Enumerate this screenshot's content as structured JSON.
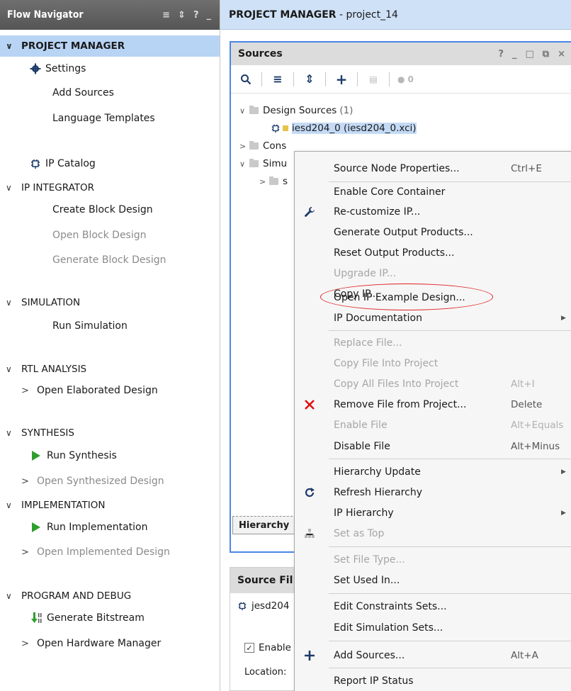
{
  "flow_navigator": {
    "title": "Flow Navigator",
    "header_icons": [
      "collapse-all-icon",
      "expand-all-icon",
      "help-icon",
      "minimize-icon"
    ],
    "sections": [
      {
        "label": "PROJECT MANAGER",
        "selected": true
      },
      {
        "label": "IP INTEGRATOR"
      },
      {
        "label": "SIMULATION"
      },
      {
        "label": "RTL ANALYSIS"
      },
      {
        "label": "SYNTHESIS"
      },
      {
        "label": "IMPLEMENTATION"
      },
      {
        "label": "PROGRAM AND DEBUG"
      }
    ],
    "items": {
      "settings": "Settings",
      "add_sources": "Add Sources",
      "language_templates": "Language Templates",
      "ip_catalog": "IP Catalog",
      "create_block_design": "Create Block Design",
      "open_block_design": "Open Block Design",
      "generate_block_design": "Generate Block Design",
      "run_simulation": "Run Simulation",
      "open_elaborated_design": "Open Elaborated Design",
      "run_synthesis": "Run Synthesis",
      "open_synthesized_design": "Open Synthesized Design",
      "run_implementation": "Run Implementation",
      "open_implemented_design": "Open Implemented Design",
      "generate_bitstream": "Generate Bitstream",
      "open_hardware_manager": "Open Hardware Manager"
    }
  },
  "project_manager": {
    "label": "PROJECT MANAGER",
    "separator": " - ",
    "project": "project_14"
  },
  "sources": {
    "title": "Sources",
    "title_icons": [
      "help-icon",
      "minimize-icon",
      "maximize-icon",
      "float-icon",
      "close-icon"
    ],
    "toolbar_badge": "0",
    "tree": {
      "design_sources": "Design Sources",
      "design_sources_count": "(1)",
      "ip_file": "iesd204_0 (iesd204_0.xci)",
      "constraints": "Cons",
      "simulation": "Simu",
      "sim_child": "s"
    },
    "bottom_tab": "Hierarchy"
  },
  "source_file_properties": {
    "title": "Source Fil",
    "file": "jesd204",
    "enable_label": "Enable",
    "location_label": "Location:"
  },
  "context_menu": {
    "items": [
      {
        "label": "Source Node Properties...",
        "shortcut": "Ctrl+E"
      },
      {
        "label": "Enable Core Container"
      },
      {
        "label": "Re-customize IP..."
      },
      {
        "label": "Generate Output Products..."
      },
      {
        "label": "Reset Output Products..."
      },
      {
        "label": "Upgrade IP...",
        "disabled": true
      },
      {
        "label": "Copy IP..."
      },
      {
        "label": "Open IP Example Design...",
        "highlighted": true
      },
      {
        "label": "IP Documentation",
        "submenu": true
      },
      {
        "label": "Replace File...",
        "disabled": true
      },
      {
        "label": "Copy File Into Project",
        "disabled": true
      },
      {
        "label": "Copy All Files Into Project",
        "shortcut": "Alt+I",
        "disabled": true
      },
      {
        "label": "Remove File from Project...",
        "shortcut": "Delete"
      },
      {
        "label": "Enable File",
        "shortcut": "Alt+Equals",
        "disabled": true
      },
      {
        "label": "Disable File",
        "shortcut": "Alt+Minus"
      },
      {
        "label": "Hierarchy Update",
        "submenu": true
      },
      {
        "label": "Refresh Hierarchy"
      },
      {
        "label": "IP Hierarchy",
        "submenu": true
      },
      {
        "label": "Set as Top",
        "disabled": true
      },
      {
        "label": "Set File Type...",
        "disabled": true
      },
      {
        "label": "Set Used In..."
      },
      {
        "label": "Edit Constraints Sets..."
      },
      {
        "label": "Edit Simulation Sets..."
      },
      {
        "label": "Add Sources...",
        "shortcut": "Alt+A"
      },
      {
        "label": "Report IP Status"
      }
    ]
  },
  "colors": {
    "selection": "#b8d4f5",
    "panel_border": "#4a86e8",
    "run_green": "#2e9e2e",
    "remove_red": "#e01010",
    "highlight_ellipse": "#e02020"
  }
}
